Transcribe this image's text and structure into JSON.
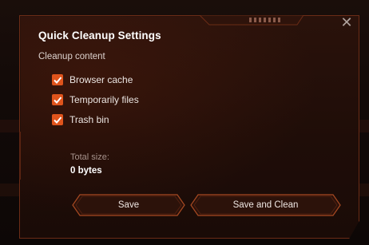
{
  "background": {
    "colors": {
      "accent": "#e0541c",
      "border": "#6b2c16",
      "panel": "#1f0d08"
    }
  },
  "dialog": {
    "title": "Quick Cleanup Settings",
    "close_icon": "close-icon",
    "section_label": "Cleanup content",
    "options": [
      {
        "label": "Browser cache",
        "checked": true
      },
      {
        "label": "Temporarily files",
        "checked": true
      },
      {
        "label": "Trash bin",
        "checked": true
      }
    ],
    "total_size_label": "Total size:",
    "total_size_value": "0 bytes",
    "buttons": {
      "save": "Save",
      "save_and_clean": "Save and Clean"
    }
  }
}
